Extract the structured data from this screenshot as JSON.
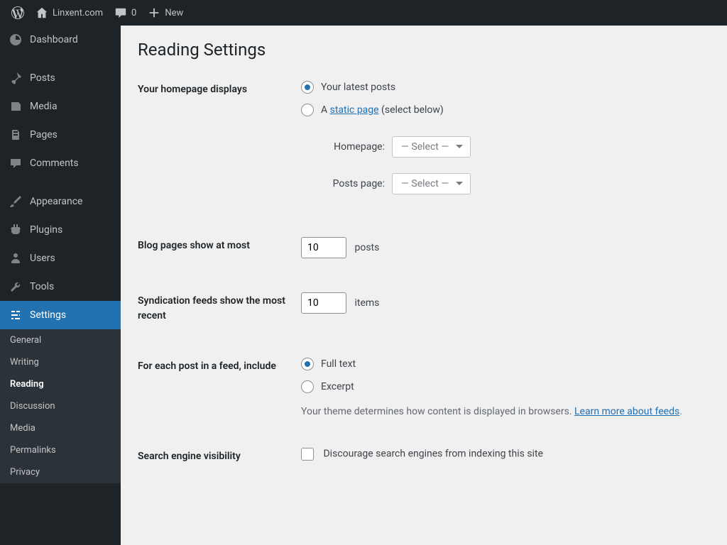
{
  "adminbar": {
    "site": "Linxent.com",
    "comments": "0",
    "new": "New"
  },
  "sidebar": {
    "dashboard": "Dashboard",
    "posts": "Posts",
    "media": "Media",
    "pages": "Pages",
    "comments": "Comments",
    "appearance": "Appearance",
    "plugins": "Plugins",
    "users": "Users",
    "tools": "Tools",
    "settings": "Settings",
    "submenu": {
      "general": "General",
      "writing": "Writing",
      "reading": "Reading",
      "discussion": "Discussion",
      "media": "Media",
      "permalinks": "Permalinks",
      "privacy": "Privacy"
    }
  },
  "page": {
    "title": "Reading Settings",
    "homepage": {
      "label": "Your homepage displays",
      "opt1": "Your latest posts",
      "opt2_prefix": "A ",
      "opt2_link": "static page",
      "opt2_suffix": " (select below)",
      "homepage_label": "Homepage:",
      "postspage_label": "Posts page:",
      "select_placeholder": "— Select —"
    },
    "blogpages": {
      "label": "Blog pages show at most",
      "value": "10",
      "suffix": "posts"
    },
    "syndication": {
      "label": "Syndication feeds show the most recent",
      "value": "10",
      "suffix": "items"
    },
    "feedinclude": {
      "label": "For each post in a feed, include",
      "opt1": "Full text",
      "opt2": "Excerpt",
      "desc_prefix": "Your theme determines how content is displayed in browsers. ",
      "desc_link": "Learn more about feeds",
      "desc_suffix": "."
    },
    "searchvis": {
      "label": "Search engine visibility",
      "checkbox": "Discourage search engines from indexing this site"
    }
  }
}
